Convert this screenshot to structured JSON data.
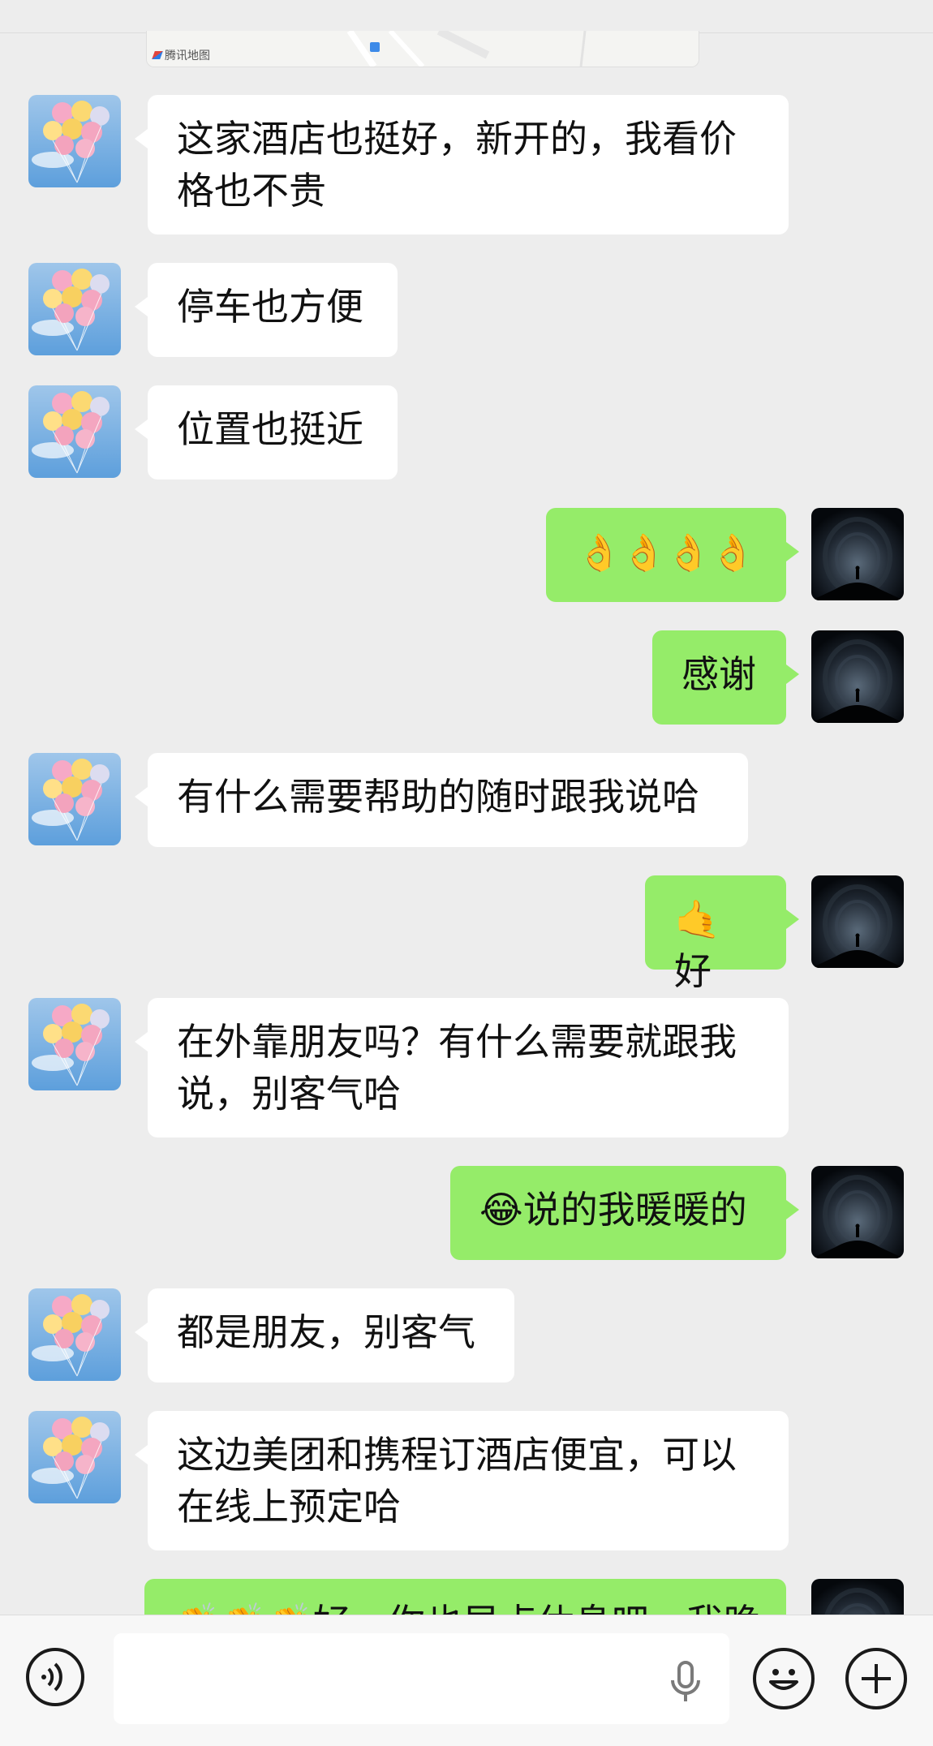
{
  "map": {
    "label": "腾讯地图"
  },
  "messages": [
    {
      "side": "left",
      "text": "这家酒店也挺好，新开的，我看价格也不贵"
    },
    {
      "side": "left",
      "text": "停车也方便"
    },
    {
      "side": "left",
      "text": "位置也挺近"
    },
    {
      "side": "right",
      "text": "👌👌👌👌"
    },
    {
      "side": "right",
      "text": "感谢"
    },
    {
      "side": "left",
      "text": "有什么需要帮助的随时跟我说哈"
    },
    {
      "side": "right",
      "text": "🤙好"
    },
    {
      "side": "left",
      "text": "在外靠朋友吗？有什么需要就跟我说，别客气哈"
    },
    {
      "side": "right",
      "text": "😂说的我暖暖的"
    },
    {
      "side": "left",
      "text": "都是朋友，别客气"
    },
    {
      "side": "left",
      "text": "这边美团和携程订酒店便宜，可以在线上预定哈"
    },
    {
      "side": "right",
      "text": "👏👏👏好，你也早点休息吧，我晚"
    }
  ],
  "input": {
    "placeholder": ""
  },
  "icons": {
    "voice": "voice-toggle-icon",
    "mic": "microphone-icon",
    "emoji": "emoji-icon",
    "plus": "plus-icon"
  },
  "colors": {
    "self_bubble": "#95ec69",
    "other_bubble": "#ffffff",
    "background": "#ededed"
  }
}
